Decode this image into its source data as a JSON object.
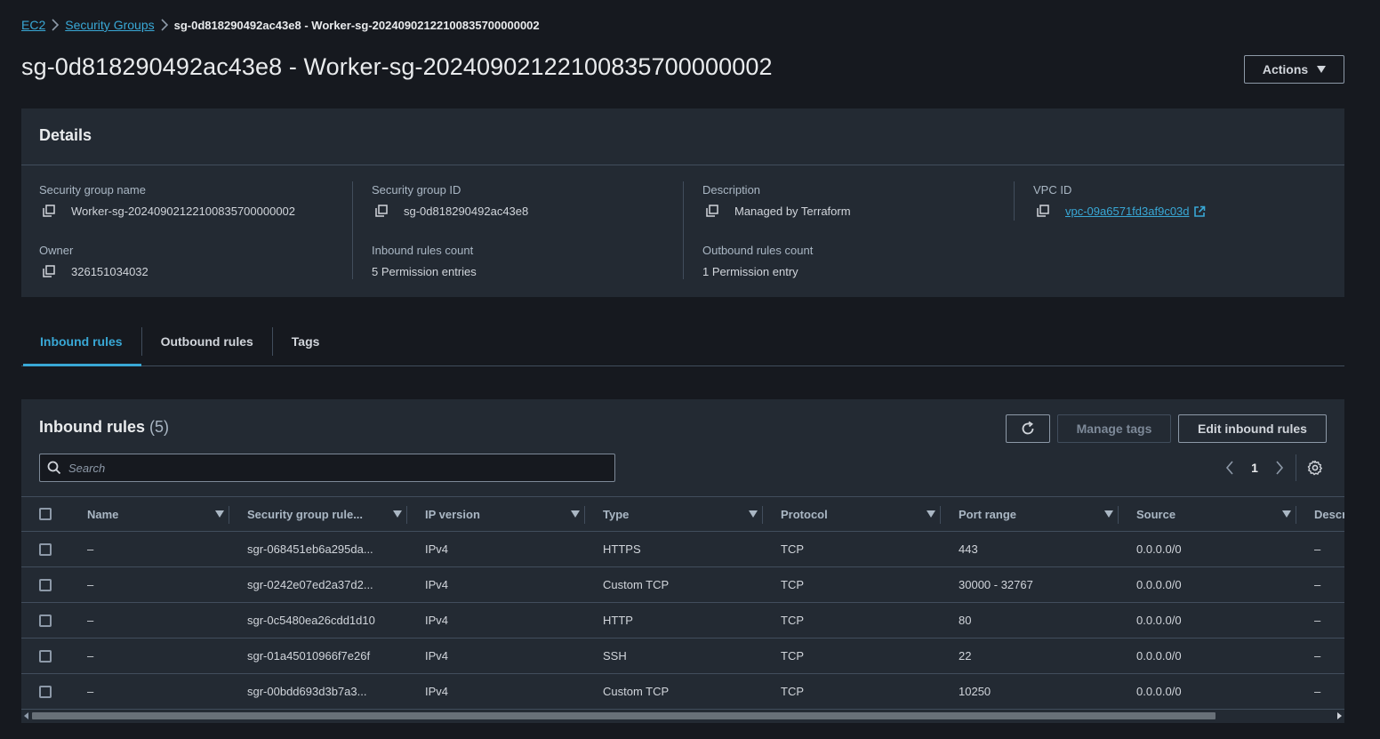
{
  "breadcrumb": {
    "ec2": "EC2",
    "security_groups": "Security Groups",
    "current": "sg-0d818290492ac43e8 - Worker-sg-20240902122100835700000002"
  },
  "header": {
    "title": "sg-0d818290492ac43e8 - Worker-sg-20240902122100835700000002",
    "actions_label": "Actions"
  },
  "details": {
    "title": "Details",
    "sg_name_label": "Security group name",
    "sg_name_value": "Worker-sg-20240902122100835700000002",
    "sg_id_label": "Security group ID",
    "sg_id_value": "sg-0d818290492ac43e8",
    "description_label": "Description",
    "description_value": "Managed by Terraform",
    "vpc_label": "VPC ID",
    "vpc_value": "vpc-09a6571fd3af9c03d",
    "owner_label": "Owner",
    "owner_value": "326151034032",
    "inbound_count_label": "Inbound rules count",
    "inbound_count_value": "5 Permission entries",
    "outbound_count_label": "Outbound rules count",
    "outbound_count_value": "1 Permission entry"
  },
  "tabs": {
    "inbound": "Inbound rules",
    "outbound": "Outbound rules",
    "tags": "Tags"
  },
  "rules": {
    "title": "Inbound rules",
    "count": "(5)",
    "manage_tags": "Manage tags",
    "edit_inbound": "Edit inbound rules",
    "search_placeholder": "Search",
    "page": "1",
    "columns": {
      "name": "Name",
      "rule_id": "Security group rule...",
      "ip_version": "IP version",
      "type": "Type",
      "protocol": "Protocol",
      "port_range": "Port range",
      "source": "Source",
      "description": "Descr"
    },
    "rows": [
      {
        "name": "–",
        "rule_id": "sgr-068451eb6a295da...",
        "ip_version": "IPv4",
        "type": "HTTPS",
        "protocol": "TCP",
        "port_range": "443",
        "source": "0.0.0.0/0",
        "description": "–"
      },
      {
        "name": "–",
        "rule_id": "sgr-0242e07ed2a37d2...",
        "ip_version": "IPv4",
        "type": "Custom TCP",
        "protocol": "TCP",
        "port_range": "30000 - 32767",
        "source": "0.0.0.0/0",
        "description": "–"
      },
      {
        "name": "–",
        "rule_id": "sgr-0c5480ea26cdd1d10",
        "ip_version": "IPv4",
        "type": "HTTP",
        "protocol": "TCP",
        "port_range": "80",
        "source": "0.0.0.0/0",
        "description": "–"
      },
      {
        "name": "–",
        "rule_id": "sgr-01a45010966f7e26f",
        "ip_version": "IPv4",
        "type": "SSH",
        "protocol": "TCP",
        "port_range": "22",
        "source": "0.0.0.0/0",
        "description": "–"
      },
      {
        "name": "–",
        "rule_id": "sgr-00bdd693d3b7a3...",
        "ip_version": "IPv4",
        "type": "Custom TCP",
        "protocol": "TCP",
        "port_range": "10250",
        "source": "0.0.0.0/0",
        "description": "–"
      }
    ]
  },
  "colors": {
    "background": "#16191f",
    "panel": "#232a33",
    "accent": "#39a8d6",
    "border": "#414d5c"
  }
}
